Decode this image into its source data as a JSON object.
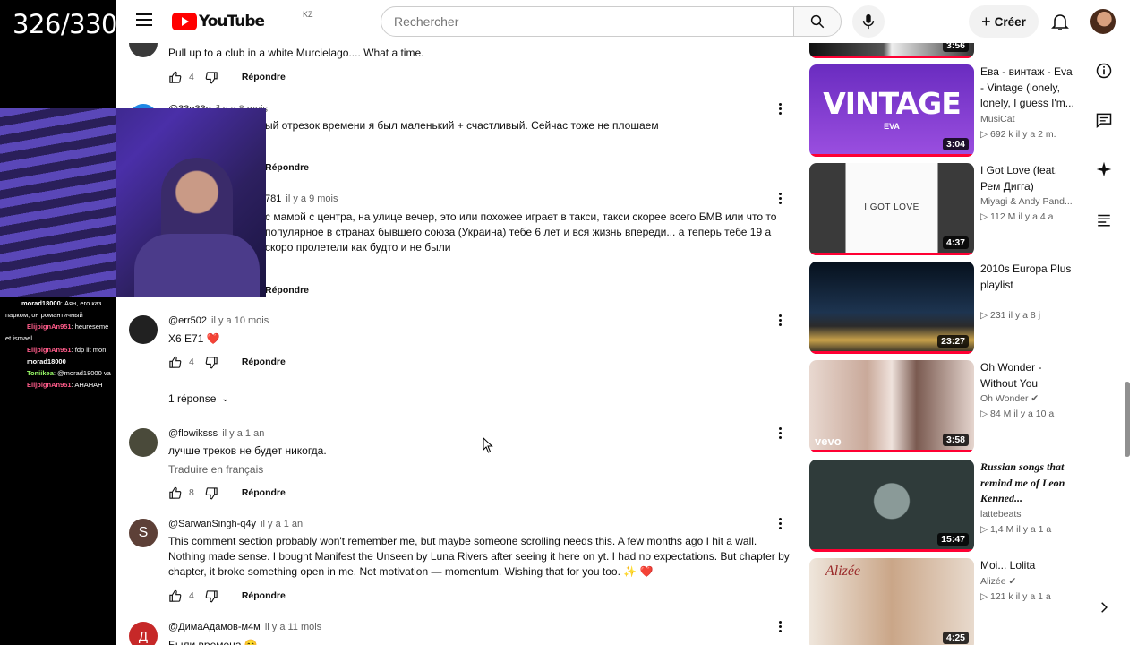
{
  "stream": {
    "counter": "326/330",
    "chat": [
      {
        "user": "morad18000",
        "text": ": Аян, его каз",
        "color": "#ffffff"
      },
      {
        "user": "",
        "text": "парком, он романтичный",
        "color": "#ffffff"
      },
      {
        "user": "ElijpignAn951",
        "text": ": heureseme",
        "color": "#ff5c8a"
      },
      {
        "user": "",
        "text": "et ismael",
        "color": "#ffffff"
      },
      {
        "user": "ElijpignAn951",
        "text": ": fdp lit mon",
        "color": "#ff5c8a"
      },
      {
        "user": "morad18000",
        "text": "",
        "color": "#ffffff"
      },
      {
        "user": "Toniikea",
        "text": ": @morad18000 va",
        "color": "#9cff6a"
      },
      {
        "user": "ElijpignAn951",
        "text": ": AHAHAH",
        "color": "#ff5c8a"
      }
    ]
  },
  "header": {
    "logo_text": "YouTube",
    "country": "KZ",
    "search_placeholder": "Rechercher",
    "create_label": "Créer"
  },
  "comments": [
    {
      "author": "",
      "time": "",
      "text": "Pull up to a club in a white Murcielago.... What a time.",
      "likes": "4",
      "reply": "Répondre",
      "avatar_color": "#3a3a3a"
    },
    {
      "author": "@33g33g",
      "time": "il y a 8 mois",
      "text": "ый отрезок времени я был маленький + счастливый. Сейчас тоже не плошаем",
      "likes": "",
      "reply": "Répondre",
      "avatar_color": "#1e88e5"
    },
    {
      "author": "",
      "time": "il y a 9 mois",
      "author_suffix": "781",
      "text": "с мамой с центра, на улице вечер, это или похожее играет в такси, такси скорее всего БМВ или что то популярное в странах бывшего союза (Украина) тебе 6 лет и вся жизнь впереди... а теперь тебе 19 а скоро пролетели как будто и не были",
      "reply": "Répondre",
      "avatar_color": "#795548"
    },
    {
      "author": "@err502",
      "time": "il y a 10 mois",
      "text": "X6 E71 ❤️",
      "likes": "4",
      "reply": "Répondre",
      "avatar_color": "#212121",
      "replies": "1 réponse"
    },
    {
      "author": "@flowiksss",
      "time": "il y a 1 an",
      "text": "лучше треков не будет никогда.",
      "translate": "Traduire en français",
      "likes": "8",
      "reply": "Répondre",
      "avatar_color": "#4a4a3a"
    },
    {
      "author": "@SarwanSingh-q4y",
      "time": "il y a 1 an",
      "text": "This comment section probably won't remember me, but maybe someone scrolling needs this. A few months ago I hit a wall. Nothing made sense. I bought Manifest the Unseen by Luna Rivers after seeing it here on yt. I had no expectations. But chapter by chapter, it broke something open in me. Not motivation — momentum. Wishing that for you too. ✨ ❤️",
      "likes": "4",
      "reply": "Répondre",
      "avatar_color": "#5d4037",
      "initial": "S"
    },
    {
      "author": "@ДимаАдамов-м4м",
      "time": "il y a 11 mois",
      "text": "Были времена 😊",
      "avatar_color": "#c62828",
      "initial": "Д"
    }
  ],
  "recommendations": [
    {
      "title": "",
      "channel": "",
      "meta": "",
      "duration": "3:56",
      "thumb": "#1a1a1a"
    },
    {
      "title": "Ева - винтаж - Eva - Vintage (lonely, lonely, I guess I'm...",
      "channel": "MusiCat",
      "meta": "▷ 692 k  il y a 2 m.",
      "duration": "3:04",
      "thumb": "#7b2fbe",
      "thumb_text": "VINTAGE",
      "thumb_sub": "EVA"
    },
    {
      "title": "I Got Love (feat. Рем Дигга)",
      "channel": "Miyagi & Andy Pand...",
      "meta": "▷ 112 M  il y a 4 a",
      "duration": "4:37",
      "thumb": "#f2f2f2",
      "thumb_text": "I GOT LOVE"
    },
    {
      "title": "2010s Europa Plus playlist",
      "channel": "",
      "meta": "▷ 231  il y a 8 j",
      "duration": "23:27",
      "thumb": "#0d1b2a"
    },
    {
      "title": "Oh Wonder - Without You",
      "channel": "Oh Wonder ✔",
      "meta": "▷ 84 M  il y a 10 a",
      "duration": "3:58",
      "thumb": "#d9c7c0",
      "thumb_text": "vevo"
    },
    {
      "title": "Russian songs that remind me of Leon Kenned...",
      "channel": "lattebeats",
      "meta": "▷ 1,4 M  il y a 1 a",
      "duration": "15:47",
      "thumb": "#2f3b3a"
    },
    {
      "title": "Moi... Lolita",
      "channel": "Alizée ✔",
      "meta": "▷ 121 k  il y a 1 a",
      "duration": "4:25",
      "thumb": "#e9dcd0",
      "thumb_text": "Alizée"
    }
  ]
}
